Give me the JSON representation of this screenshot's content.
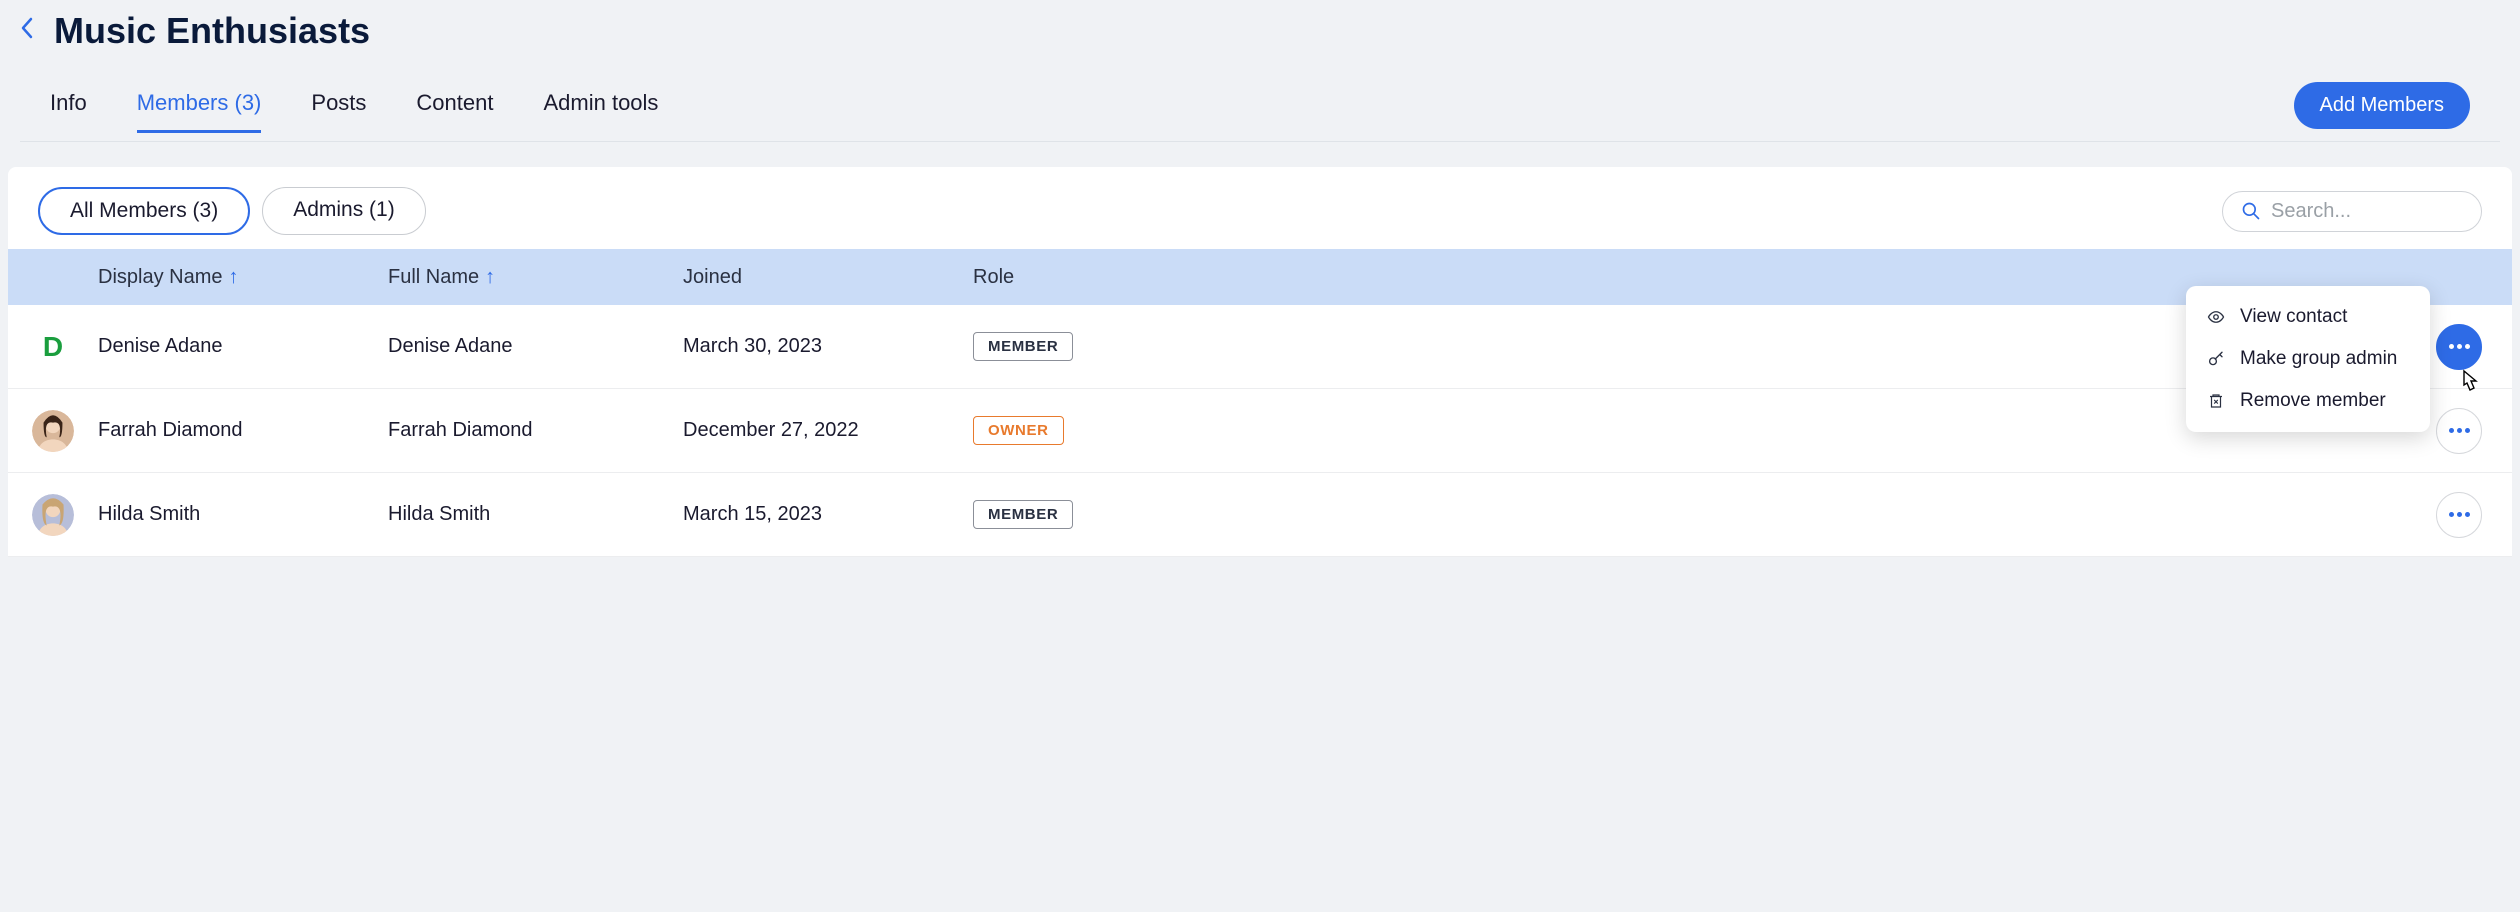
{
  "header": {
    "title": "Music Enthusiasts"
  },
  "tabs": {
    "info": "Info",
    "members": "Members (3)",
    "posts": "Posts",
    "content": "Content",
    "admin_tools": "Admin tools"
  },
  "buttons": {
    "add_members": "Add Members"
  },
  "filters": {
    "all_members": "All Members (3)",
    "admins": "Admins (1)"
  },
  "search": {
    "placeholder": "Search..."
  },
  "table": {
    "headers": {
      "display_name": "Display Name",
      "full_name": "Full Name",
      "joined": "Joined",
      "role": "Role"
    },
    "rows": [
      {
        "avatar_type": "letter",
        "avatar_letter": "D",
        "display_name": "Denise Adane",
        "full_name": "Denise Adane",
        "joined": "March 30, 2023",
        "role": "MEMBER",
        "role_class": "role-member"
      },
      {
        "avatar_type": "image",
        "display_name": "Farrah Diamond",
        "full_name": "Farrah Diamond",
        "joined": "December 27, 2022",
        "role": "OWNER",
        "role_class": "role-owner"
      },
      {
        "avatar_type": "image",
        "display_name": "Hilda Smith",
        "full_name": "Hilda Smith",
        "joined": "March 15, 2023",
        "role": "MEMBER",
        "role_class": "role-member"
      }
    ]
  },
  "dropdown": {
    "view_contact": "View contact",
    "make_admin": "Make group admin",
    "remove_member": "Remove member"
  }
}
